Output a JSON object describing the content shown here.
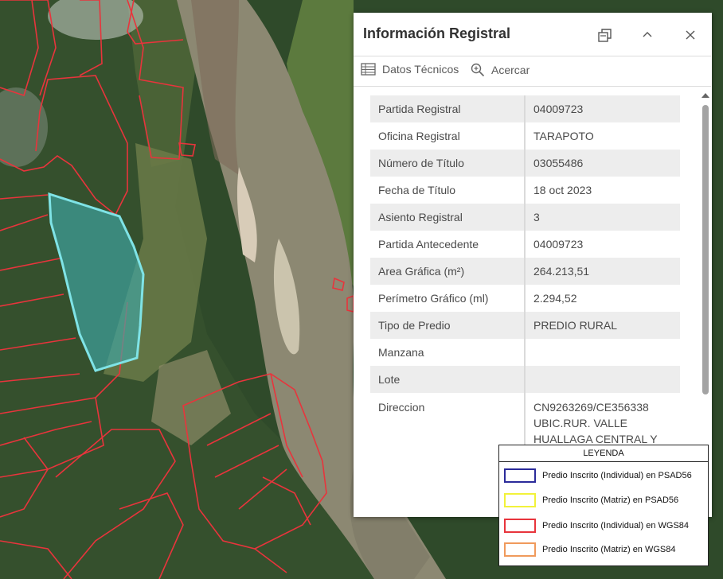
{
  "popup": {
    "title": "Información Registral",
    "toolbar": {
      "technical": "Datos Técnicos",
      "zoom": "Acercar"
    },
    "attributes": [
      {
        "label": "Partida Registral",
        "value": "04009723"
      },
      {
        "label": "Oficina Registral",
        "value": "TARAPOTO"
      },
      {
        "label": "Número de Título",
        "value": "03055486"
      },
      {
        "label": "Fecha de Título",
        "value": "18 oct 2023"
      },
      {
        "label": "Asiento Registral",
        "value": "3"
      },
      {
        "label": "Partida Antecedente",
        "value": "04009723"
      },
      {
        "label": "Area Gráfica (m²)",
        "value": "264.213,51"
      },
      {
        "label": "Perímetro Gráfico (ml)",
        "value": "2.294,52"
      },
      {
        "label": "Tipo de Predio",
        "value": "PREDIO RURAL"
      },
      {
        "label": "Manzana",
        "value": ""
      },
      {
        "label": "Lote",
        "value": ""
      },
      {
        "label": "Direccion",
        "value_lines": [
          "CN9263269/CE356338",
          "UBIC.RUR. VALLE",
          "HUALLAGA CENTRAL Y"
        ]
      }
    ]
  },
  "legend": {
    "title": "LEYENDA",
    "items": [
      {
        "label": "Predio Inscrito (Individual) en PSAD56",
        "color": "#2b2b9a"
      },
      {
        "label": "Predio Inscrito (Matriz) en PSAD56",
        "color": "#f2f23a"
      },
      {
        "label": "Predio Inscrito (Individual) en WGS84",
        "color": "#e8343c"
      },
      {
        "label": "Predio Inscrito (Matriz) en WGS84",
        "color": "#f09a5c"
      }
    ]
  },
  "map": {
    "parcel_line_color": "#e8343c",
    "selected_fill": "#3fa8a8",
    "selected_outline": "#7fe3e6",
    "river_color": "#8c8872"
  }
}
